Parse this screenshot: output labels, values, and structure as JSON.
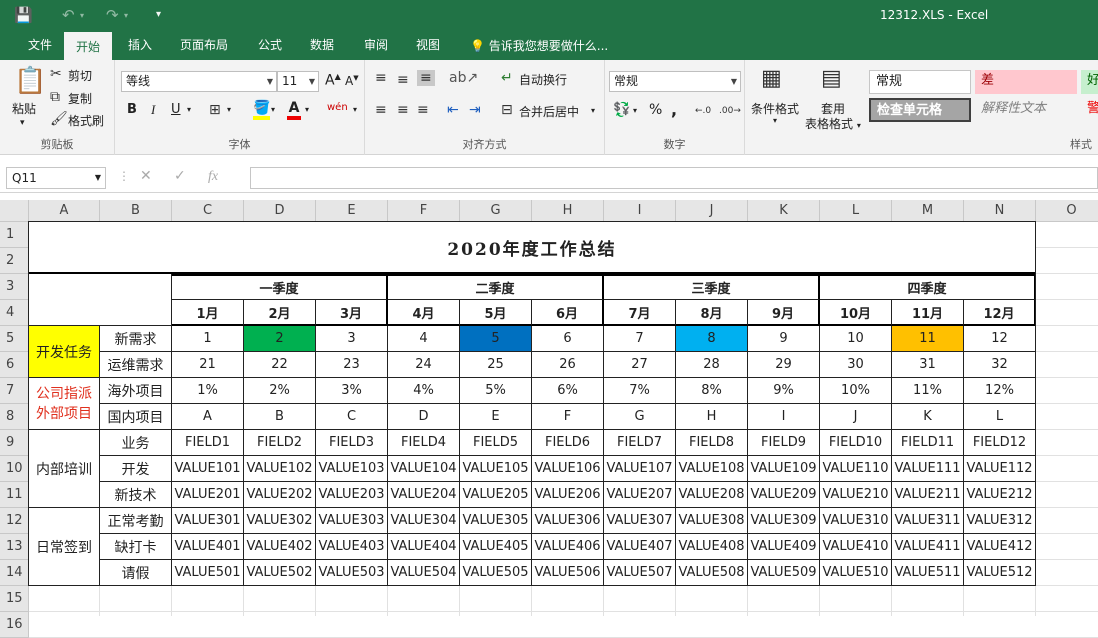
{
  "window": {
    "title": "12312.XLS - Excel"
  },
  "tabs": [
    "文件",
    "开始",
    "插入",
    "页面布局",
    "公式",
    "数据",
    "审阅",
    "视图"
  ],
  "tell_me": "告诉我您想要做什么...",
  "ribbon": {
    "clipboard": {
      "paste": "粘贴",
      "cut": "剪切",
      "copy": "复制",
      "format_painter": "格式刷",
      "label": "剪贴板"
    },
    "font": {
      "name": "等线",
      "size": "11",
      "label": "字体",
      "grow": "A",
      "shrink": "A",
      "bold": "B",
      "italic": "I",
      "underline": "U"
    },
    "alignment": {
      "wrap": "自动换行",
      "merge": "合并后居中",
      "label": "对齐方式"
    },
    "number": {
      "format": "常规",
      "label": "数字",
      "percent": "%",
      "comma": ","
    },
    "styles": {
      "cond_format": "条件格式",
      "table_format_1": "套用",
      "table_format_2": "表格格式",
      "normal": "常规",
      "bad": "差",
      "good": "好",
      "check": "检查单元格",
      "explain": "解释性文本",
      "warn": "警",
      "label": "样式"
    }
  },
  "formula_bar": {
    "name_box": "Q11",
    "fx": "fx"
  },
  "sheet": {
    "columns": [
      "A",
      "B",
      "C",
      "D",
      "E",
      "F",
      "G",
      "H",
      "I",
      "J",
      "K",
      "L",
      "M",
      "N",
      "O"
    ],
    "rows": [
      "1",
      "2",
      "3",
      "4",
      "5",
      "6",
      "7",
      "8",
      "9",
      "10",
      "11",
      "12",
      "13",
      "14",
      "15",
      "16"
    ],
    "title": "2020年度工作总结",
    "quarters": [
      "一季度",
      "二季度",
      "三季度",
      "四季度"
    ],
    "months": [
      "1月",
      "2月",
      "3月",
      "4月",
      "5月",
      "6月",
      "7月",
      "8月",
      "9月",
      "10月",
      "11月",
      "12月"
    ],
    "groups": [
      {
        "label": "开发任务",
        "bg": "#ffff00",
        "color": "#222222"
      },
      {
        "label": "公司指派\n外部项目",
        "bg": "#ffffff",
        "color": "#e0301e"
      },
      {
        "label": "内部培训",
        "bg": "#ffffff",
        "color": "#222222"
      },
      {
        "label": "日常签到",
        "bg": "#ffffff",
        "color": "#222222"
      }
    ],
    "row_labels": [
      "新需求",
      "运维需求",
      "海外项目",
      "国内项目",
      "业务",
      "开发",
      "新技术",
      "正常考勤",
      "缺打卡",
      "请假"
    ],
    "data": [
      [
        "1",
        "2",
        "3",
        "4",
        "5",
        "6",
        "7",
        "8",
        "9",
        "10",
        "11",
        "12"
      ],
      [
        "21",
        "22",
        "23",
        "24",
        "25",
        "26",
        "27",
        "28",
        "29",
        "30",
        "31",
        "32"
      ],
      [
        "1%",
        "2%",
        "3%",
        "4%",
        "5%",
        "6%",
        "7%",
        "8%",
        "9%",
        "10%",
        "11%",
        "12%"
      ],
      [
        "A",
        "B",
        "C",
        "D",
        "E",
        "F",
        "G",
        "H",
        "I",
        "J",
        "K",
        "L"
      ],
      [
        "FIELD1",
        "FIELD2",
        "FIELD3",
        "FIELD4",
        "FIELD5",
        "FIELD6",
        "FIELD7",
        "FIELD8",
        "FIELD9",
        "FIELD10",
        "FIELD11",
        "FIELD12"
      ],
      [
        "VALUE101",
        "VALUE102",
        "VALUE103",
        "VALUE104",
        "VALUE105",
        "VALUE106",
        "VALUE107",
        "VALUE108",
        "VALUE109",
        "VALUE110",
        "VALUE111",
        "VALUE112"
      ],
      [
        "VALUE201",
        "VALUE202",
        "VALUE203",
        "VALUE204",
        "VALUE205",
        "VALUE206",
        "VALUE207",
        "VALUE208",
        "VALUE209",
        "VALUE210",
        "VALUE211",
        "VALUE212"
      ],
      [
        "VALUE301",
        "VALUE302",
        "VALUE303",
        "VALUE304",
        "VALUE305",
        "VALUE306",
        "VALUE307",
        "VALUE308",
        "VALUE309",
        "VALUE310",
        "VALUE311",
        "VALUE312"
      ],
      [
        "VALUE401",
        "VALUE402",
        "VALUE403",
        "VALUE404",
        "VALUE405",
        "VALUE406",
        "VALUE407",
        "VALUE408",
        "VALUE409",
        "VALUE410",
        "VALUE411",
        "VALUE412"
      ],
      [
        "VALUE501",
        "VALUE502",
        "VALUE503",
        "VALUE504",
        "VALUE505",
        "VALUE506",
        "VALUE507",
        "VALUE508",
        "VALUE509",
        "VALUE510",
        "VALUE511",
        "VALUE512"
      ]
    ],
    "highlights": [
      {
        "row": 0,
        "col": 1,
        "bg": "#00b050"
      },
      {
        "row": 0,
        "col": 4,
        "bg": "#0070c0"
      },
      {
        "row": 0,
        "col": 7,
        "bg": "#00b0f0"
      },
      {
        "row": 0,
        "col": 10,
        "bg": "#ffc000"
      }
    ]
  },
  "colors": {
    "excel_green": "#217346"
  }
}
